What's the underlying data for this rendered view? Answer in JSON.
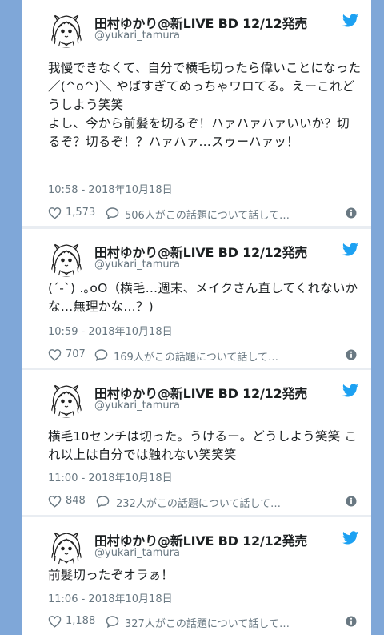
{
  "colors": {
    "background": "#7fa7d8",
    "card": "#ffffff",
    "text": "#1c2022",
    "meta": "#697882",
    "twitter_blue": "#1da1f2"
  },
  "tweets": [
    {
      "name": "田村ゆかり@新LIVE BD 12/12発売",
      "handle": "@yukari_tamura",
      "text": "我慢できなくて、自分で横毛切ったら偉いことになった／(^o^)＼ やばすぎてめっちゃワロてる。えーこれどうしよう笑笑\nよし、今から前髪を切るぞ！ハァハァハァいいか？切るぞ？切るぞ！？ハァハァ…スゥーハァッ！",
      "timestamp": "10:58 - 2018年10月18日",
      "likes": "1,573",
      "replies": "506人がこの話題について話して…"
    },
    {
      "name": "田村ゆかり@新LIVE BD 12/12発売",
      "handle": "@yukari_tamura",
      "text": "(´-`) .｡oO（横毛…週末、メイクさん直してくれないかな…無理かな…？)",
      "timestamp": "10:59 - 2018年10月18日",
      "likes": "707",
      "replies": "169人がこの話題について話して…"
    },
    {
      "name": "田村ゆかり@新LIVE BD 12/12発売",
      "handle": "@yukari_tamura",
      "text": "横毛10センチは切った。うけるー。どうしよう笑笑 これ以上は自分では触れない笑笑笑",
      "timestamp": "11:00 - 2018年10月18日",
      "likes": "848",
      "replies": "232人がこの話題について話して…"
    },
    {
      "name": "田村ゆかり@新LIVE BD 12/12発売",
      "handle": "@yukari_tamura",
      "text": "前髪切ったぞオラぁ！",
      "timestamp": "11:06 - 2018年10月18日",
      "likes": "1,188",
      "replies": "327人がこの話題について話して…"
    }
  ]
}
